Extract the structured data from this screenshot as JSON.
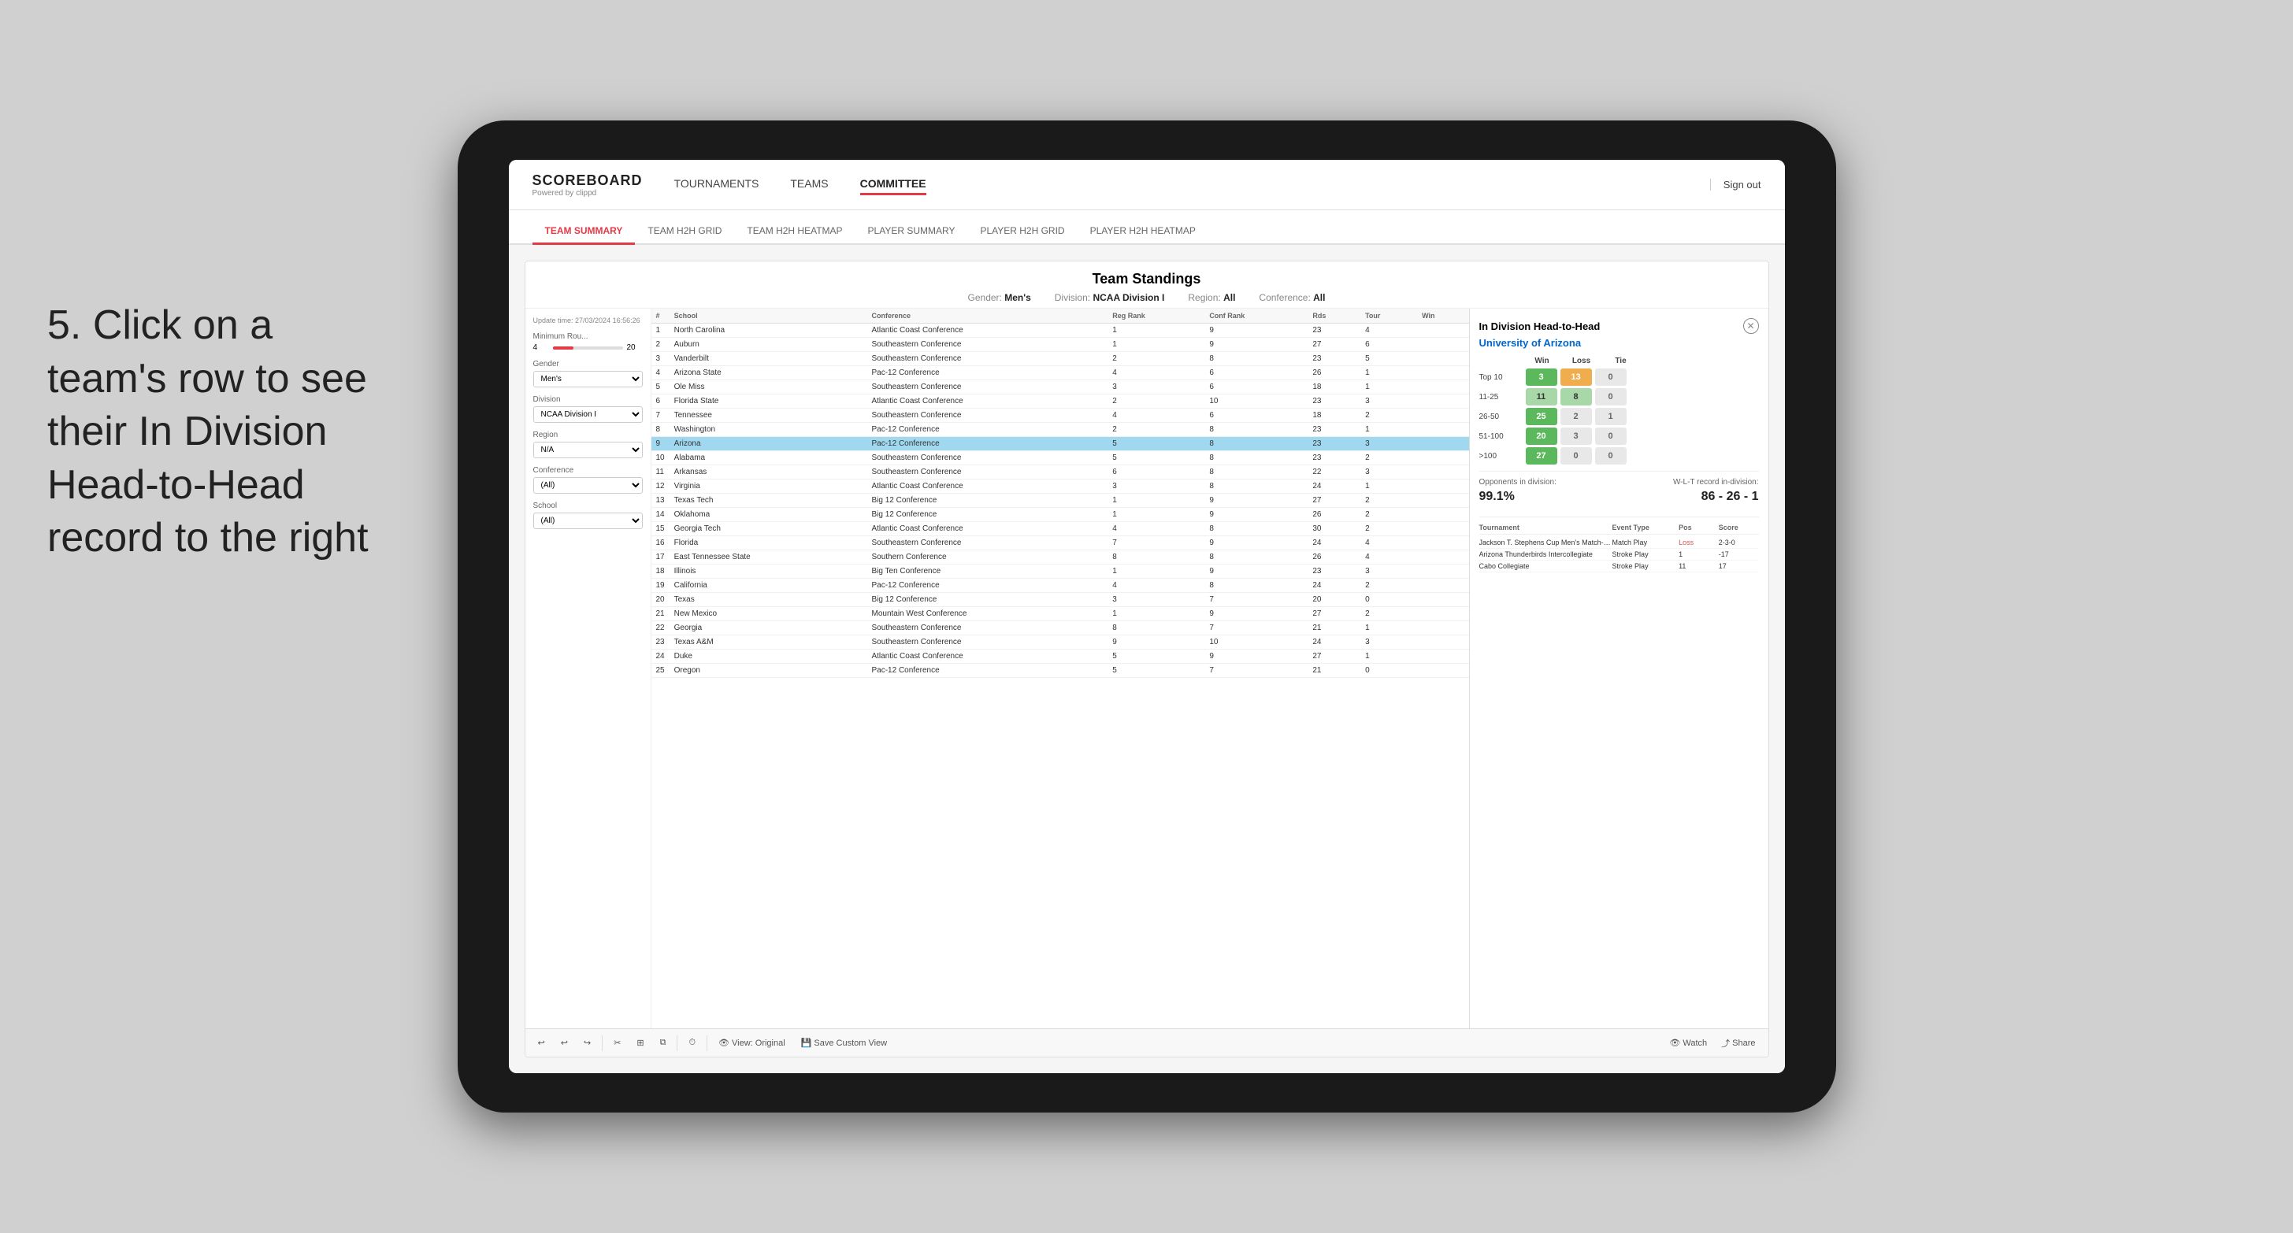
{
  "annotation": {
    "text": "5. Click on a team's row to see their In Division Head-to-Head record to the right"
  },
  "nav": {
    "logo": "SCOREBOARD",
    "logo_sub": "Powered by clippd",
    "links": [
      "TOURNAMENTS",
      "TEAMS",
      "COMMITTEE"
    ],
    "active_link": "COMMITTEE",
    "sign_out": "Sign out"
  },
  "sub_tabs": [
    "TEAM SUMMARY",
    "TEAM H2H GRID",
    "TEAM H2H HEATMAP",
    "PLAYER SUMMARY",
    "PLAYER H2H GRID",
    "PLAYER H2H HEATMAP"
  ],
  "active_sub_tab": "PLAYER SUMMARY",
  "content": {
    "title": "Team Standings",
    "update_time": "Update time: 27/03/2024 16:56:26",
    "filters": {
      "gender_label": "Gender:",
      "gender_value": "Men's",
      "division_label": "Division:",
      "division_value": "NCAA Division I",
      "region_label": "Region:",
      "region_value": "All",
      "conference_label": "Conference:",
      "conference_value": "All"
    }
  },
  "sidebar": {
    "min_rounds_label": "Minimum Rou...",
    "min_rounds_value": "4",
    "min_rounds_max": "20",
    "gender_label": "Gender",
    "gender_value": "Men's",
    "division_label": "Division",
    "division_value": "NCAA Division I",
    "region_label": "Region",
    "region_value": "N/A",
    "conference_label": "Conference",
    "conference_value": "(All)",
    "school_label": "School",
    "school_value": "(All)"
  },
  "standings": {
    "columns": [
      "#",
      "School",
      "Conference",
      "Reg Rank",
      "Conf Rank",
      "Rds",
      "Tour",
      "Win"
    ],
    "rows": [
      {
        "rank": 1,
        "school": "North Carolina",
        "conference": "Atlantic Coast Conference",
        "reg_rank": 1,
        "conf_rank": 9,
        "rds": 23,
        "tour": 4,
        "win": "",
        "highlighted": false
      },
      {
        "rank": 2,
        "school": "Auburn",
        "conference": "Southeastern Conference",
        "reg_rank": 1,
        "conf_rank": 9,
        "rds": 27,
        "tour": 6,
        "win": "",
        "highlighted": false
      },
      {
        "rank": 3,
        "school": "Vanderbilt",
        "conference": "Southeastern Conference",
        "reg_rank": 2,
        "conf_rank": 8,
        "rds": 23,
        "tour": 5,
        "win": "",
        "highlighted": false
      },
      {
        "rank": 4,
        "school": "Arizona State",
        "conference": "Pac-12 Conference",
        "reg_rank": 4,
        "conf_rank": 6,
        "rds": 26,
        "tour": 1,
        "win": "",
        "highlighted": false
      },
      {
        "rank": 5,
        "school": "Ole Miss",
        "conference": "Southeastern Conference",
        "reg_rank": 3,
        "conf_rank": 6,
        "rds": 18,
        "tour": 1,
        "win": "",
        "highlighted": false
      },
      {
        "rank": 6,
        "school": "Florida State",
        "conference": "Atlantic Coast Conference",
        "reg_rank": 2,
        "conf_rank": 10,
        "rds": 23,
        "tour": 3,
        "win": "",
        "highlighted": false
      },
      {
        "rank": 7,
        "school": "Tennessee",
        "conference": "Southeastern Conference",
        "reg_rank": 4,
        "conf_rank": 6,
        "rds": 18,
        "tour": 2,
        "win": "",
        "highlighted": false
      },
      {
        "rank": 8,
        "school": "Washington",
        "conference": "Pac-12 Conference",
        "reg_rank": 2,
        "conf_rank": 8,
        "rds": 23,
        "tour": 1,
        "win": "",
        "highlighted": false
      },
      {
        "rank": 9,
        "school": "Arizona",
        "conference": "Pac-12 Conference",
        "reg_rank": 5,
        "conf_rank": 8,
        "rds": 23,
        "tour": 3,
        "win": "",
        "highlighted": true
      },
      {
        "rank": 10,
        "school": "Alabama",
        "conference": "Southeastern Conference",
        "reg_rank": 5,
        "conf_rank": 8,
        "rds": 23,
        "tour": 2,
        "win": "",
        "highlighted": false
      },
      {
        "rank": 11,
        "school": "Arkansas",
        "conference": "Southeastern Conference",
        "reg_rank": 6,
        "conf_rank": 8,
        "rds": 22,
        "tour": 3,
        "win": "",
        "highlighted": false
      },
      {
        "rank": 12,
        "school": "Virginia",
        "conference": "Atlantic Coast Conference",
        "reg_rank": 3,
        "conf_rank": 8,
        "rds": 24,
        "tour": 1,
        "win": "",
        "highlighted": false
      },
      {
        "rank": 13,
        "school": "Texas Tech",
        "conference": "Big 12 Conference",
        "reg_rank": 1,
        "conf_rank": 9,
        "rds": 27,
        "tour": 2,
        "win": "",
        "highlighted": false
      },
      {
        "rank": 14,
        "school": "Oklahoma",
        "conference": "Big 12 Conference",
        "reg_rank": 1,
        "conf_rank": 9,
        "rds": 26,
        "tour": 2,
        "win": "",
        "highlighted": false
      },
      {
        "rank": 15,
        "school": "Georgia Tech",
        "conference": "Atlantic Coast Conference",
        "reg_rank": 4,
        "conf_rank": 8,
        "rds": 30,
        "tour": 2,
        "win": "",
        "highlighted": false
      },
      {
        "rank": 16,
        "school": "Florida",
        "conference": "Southeastern Conference",
        "reg_rank": 7,
        "conf_rank": 9,
        "rds": 24,
        "tour": 4,
        "win": "",
        "highlighted": false
      },
      {
        "rank": 17,
        "school": "East Tennessee State",
        "conference": "Southern Conference",
        "reg_rank": 8,
        "conf_rank": 8,
        "rds": 26,
        "tour": 4,
        "win": "",
        "highlighted": false
      },
      {
        "rank": 18,
        "school": "Illinois",
        "conference": "Big Ten Conference",
        "reg_rank": 1,
        "conf_rank": 9,
        "rds": 23,
        "tour": 3,
        "win": "",
        "highlighted": false
      },
      {
        "rank": 19,
        "school": "California",
        "conference": "Pac-12 Conference",
        "reg_rank": 4,
        "conf_rank": 8,
        "rds": 24,
        "tour": 2,
        "win": "",
        "highlighted": false
      },
      {
        "rank": 20,
        "school": "Texas",
        "conference": "Big 12 Conference",
        "reg_rank": 3,
        "conf_rank": 7,
        "rds": 20,
        "tour": 0,
        "win": "",
        "highlighted": false
      },
      {
        "rank": 21,
        "school": "New Mexico",
        "conference": "Mountain West Conference",
        "reg_rank": 1,
        "conf_rank": 9,
        "rds": 27,
        "tour": 2,
        "win": "",
        "highlighted": false
      },
      {
        "rank": 22,
        "school": "Georgia",
        "conference": "Southeastern Conference",
        "reg_rank": 8,
        "conf_rank": 7,
        "rds": 21,
        "tour": 1,
        "win": "",
        "highlighted": false
      },
      {
        "rank": 23,
        "school": "Texas A&M",
        "conference": "Southeastern Conference",
        "reg_rank": 9,
        "conf_rank": 10,
        "rds": 24,
        "tour": 3,
        "win": "",
        "highlighted": false
      },
      {
        "rank": 24,
        "school": "Duke",
        "conference": "Atlantic Coast Conference",
        "reg_rank": 5,
        "conf_rank": 9,
        "rds": 27,
        "tour": 1,
        "win": "",
        "highlighted": false
      },
      {
        "rank": 25,
        "school": "Oregon",
        "conference": "Pac-12 Conference",
        "reg_rank": 5,
        "conf_rank": 7,
        "rds": 21,
        "tour": 0,
        "win": "",
        "highlighted": false
      }
    ]
  },
  "h2h": {
    "title": "In Division Head-to-Head",
    "team_name": "University of Arizona",
    "wlt_headers": [
      "Win",
      "Loss",
      "Tie"
    ],
    "rows": [
      {
        "range": "Top 10",
        "win": 3,
        "loss": 13,
        "tie": 0,
        "win_color": "green",
        "loss_color": "orange",
        "tie_color": "gray"
      },
      {
        "range": "11-25",
        "win": 11,
        "loss": 8,
        "tie": 0,
        "win_color": "lightgreen",
        "loss_color": "lightgreen",
        "tie_color": "gray"
      },
      {
        "range": "26-50",
        "win": 25,
        "loss": 2,
        "tie": 1,
        "win_color": "green",
        "loss_color": "gray",
        "tie_color": "gray"
      },
      {
        "range": "51-100",
        "win": 20,
        "loss": 3,
        "tie": 0,
        "win_color": "green",
        "loss_color": "gray",
        "tie_color": "gray"
      },
      {
        "range": ">100",
        "win": 27,
        "loss": 0,
        "tie": 0,
        "win_color": "green",
        "loss_color": "gray",
        "tie_color": "gray"
      }
    ],
    "opponents_label": "Opponents in division:",
    "opponents_value": "99.1%",
    "record_label": "W-L-T record in-division:",
    "record_value": "86 - 26 - 1",
    "tournament_columns": [
      "Tournament",
      "Event Type",
      "Pos",
      "Score"
    ],
    "tournament_rows": [
      {
        "name": "Jackson T. Stephens Cup Men's Match-Play Round",
        "type": "Match Play",
        "pos": "Loss",
        "score": "2-3-0"
      },
      {
        "name": "Arizona Thunderbirds Intercollegiate",
        "type": "Stroke Play",
        "pos": "1",
        "score": "-17"
      },
      {
        "name": "Cabo Collegiate",
        "type": "Stroke Play",
        "pos": "11",
        "score": "17"
      }
    ]
  },
  "toolbar": {
    "undo": "↩",
    "redo_small": "↪",
    "forward": "⟩",
    "view_original": "View: Original",
    "save_custom": "Save Custom View",
    "watch": "Watch",
    "share": "Share"
  }
}
